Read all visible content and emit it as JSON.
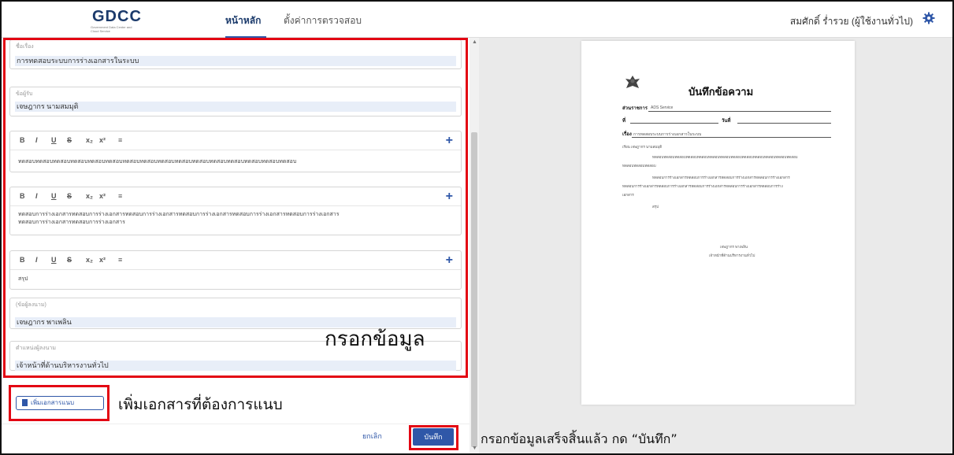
{
  "header": {
    "logo": "GDCC",
    "logo_sub": "Government Data Center and Cloud Service",
    "nav": [
      {
        "label": "หน้าหลัก"
      },
      {
        "label": "ตั้งค่าการตรวจสอบ"
      }
    ],
    "user": "สมศักดิ์ ร่ำรวย (ผู้ใช้งานทั่วไป)"
  },
  "form": {
    "subject": {
      "label": "ชื่อเรื่อง",
      "value": "การทดสอบระบบการร่างเอกสารในระบบ"
    },
    "recipient": {
      "label": "ข้อผู้รับ",
      "value": "เจษฎากร นามสมมุติ"
    },
    "toolbar": {
      "bold": "B",
      "italic": "I",
      "underline": "U",
      "strike": "S",
      "sub": "x₂",
      "sup": "x²",
      "align": "≡",
      "add": "+"
    },
    "editor1": "ทดสอบทดสอบทดสอบทดสอบทดสอบทดสอบทดสอบทดสอบทดสอบทดสอบทดสอบทดสอบทดสอบทดสอบทดสอบทดสอบ",
    "editor2_line1": "ทดสอบการร่างเอกสารทดสอบการร่างเอกสารทดสอบการร่างเอกสารทดสอบการร่างเอกสารทดสอบการร่างเอกสารทดสอบการร่างเอกสาร",
    "editor2_line2": "ทดสอบการร่างเอกสารทดสอบการร่างเอกสาร",
    "editor3": "สรุป",
    "signer": {
      "label": "(ข้อผู้ลงนาม)",
      "value": "เจษฎากร พาเพลิน"
    },
    "position": {
      "label": "ตำแหน่งผู้ลงนาม",
      "value": "เจ้าหน้าที่ด้านบริหารงานทั่วไป"
    },
    "fill_annotation": "กรอกข้อมูล",
    "attach_button": "เพิ่มเอกสารแนบ",
    "attach_annotation": "เพิ่มเอกสารที่ต้องการแนบ",
    "cancel": "ยกเลิก",
    "save": "บันทึก",
    "save_annotation": "กรอกข้อมูลเสร็จสิ้นแล้ว กด “บันทึก”"
  },
  "preview": {
    "title": "บันทึกข้อความ",
    "agency_label": "ส่วนราชการ",
    "agency_value": "ADS Service",
    "ref_label": "ที่",
    "date_label": "วันที่",
    "subject_label": "เรื่อง",
    "subject_value": "การทดสอบระบบการร่างเอกสารในระบบ",
    "to_line": "เรียน  เจษฎากร นามสมมุติ",
    "body1a": "ทดสอบทดสอบทดสอบทดสอบทดสอบทดสอบทดสอบทดสอบทดสอบทดสอบทดสอบทดสอบทดสอบ",
    "body1b": "ทดสอบทดสอบทดสอบ",
    "body2a": "ทดสอบการร่างเอกสารทดสอบการร่างเอกสารทดสอบการร่างเอกสารทดสอบการร่างเอกสาร",
    "body2b": "ทดสอบการร่างเอกสารทดสอบการร่างเอกสารทดสอบการร่างเอกสารทดสอบการร่างเอกสารทดสอบการร่าง",
    "body2c": "เอกสาร",
    "summary": "สรุป",
    "signer": "เจษฎากร พาเพลิน",
    "signer_position": "เจ้าหน้าที่ด้านบริหารงานทั่วไป"
  },
  "colors": {
    "accent": "#2f57a8",
    "annotation": "#e30613",
    "field_bg": "#e8eef8"
  }
}
